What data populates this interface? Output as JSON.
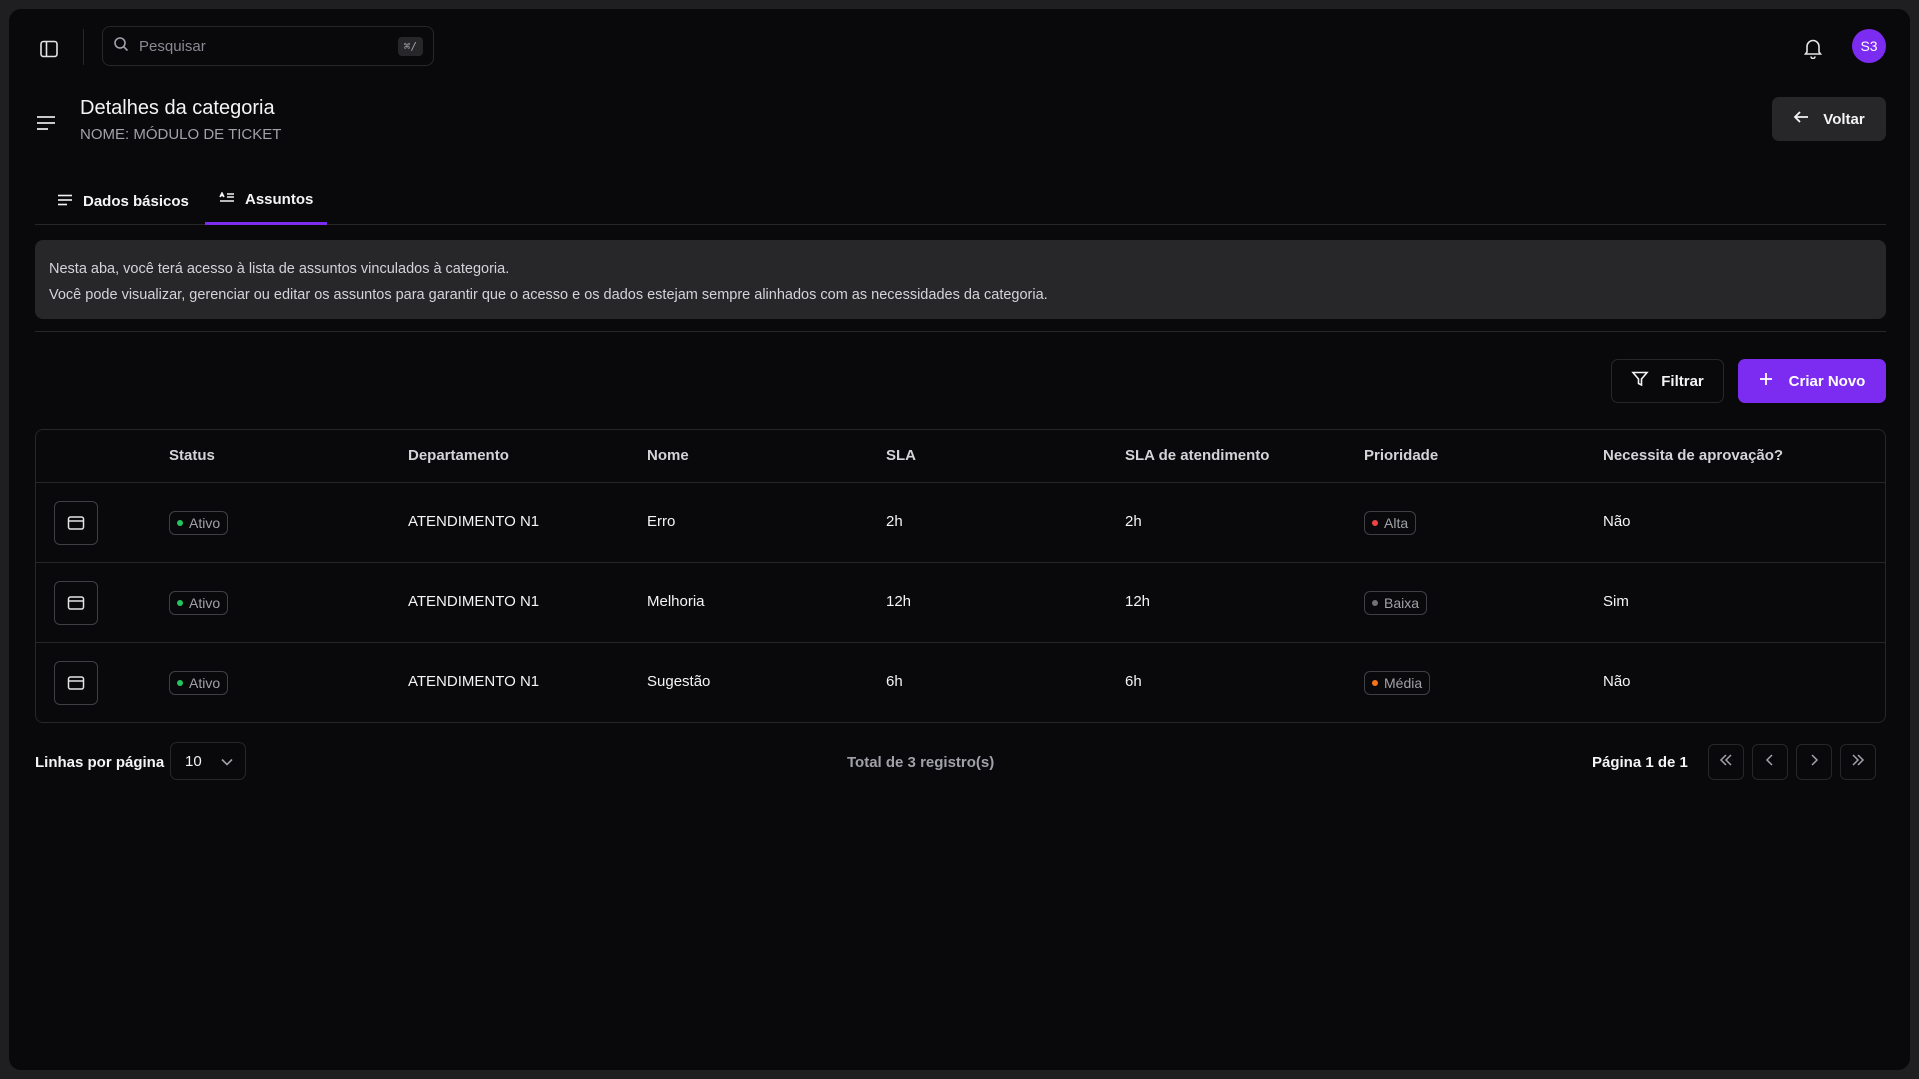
{
  "topbar": {
    "search_placeholder": "Pesquisar",
    "search_shortcut": "⌘/",
    "avatar_initials": "S3"
  },
  "header": {
    "title": "Detalhes da categoria",
    "subtitle": "NOME: MÓDULO DE TICKET",
    "back_label": "Voltar"
  },
  "tabs": [
    {
      "label": "Dados básicos",
      "icon": "lines-icon",
      "active": false
    },
    {
      "label": "Assuntos",
      "icon": "list-text-icon",
      "active": true
    }
  ],
  "info": {
    "line1": "Nesta aba, você terá acesso à lista de assuntos vinculados à categoria.",
    "line2": "Você pode visualizar, gerenciar ou editar os assuntos para garantir que o acesso e os dados estejam sempre alinhados com as necessidades da categoria."
  },
  "actions": {
    "filter_label": "Filtrar",
    "create_label": "Criar Novo"
  },
  "table": {
    "columns": [
      "Status",
      "Departamento",
      "Nome",
      "SLA",
      "SLA de atendimento",
      "Prioridade",
      "Necessita de aprovação?"
    ],
    "rows": [
      {
        "status": "Ativo",
        "departamento": "ATENDIMENTO N1",
        "nome": "Erro",
        "sla": "2h",
        "sla_atendimento": "2h",
        "prioridade": "Alta",
        "aprovacao": "Não"
      },
      {
        "status": "Ativo",
        "departamento": "ATENDIMENTO N1",
        "nome": "Melhoria",
        "sla": "12h",
        "sla_atendimento": "12h",
        "prioridade": "Baixa",
        "aprovacao": "Sim"
      },
      {
        "status": "Ativo",
        "departamento": "ATENDIMENTO N1",
        "nome": "Sugestão",
        "sla": "6h",
        "sla_atendimento": "6h",
        "prioridade": "Média",
        "aprovacao": "Não"
      }
    ]
  },
  "pagination": {
    "rows_per_page_label": "Linhas por página",
    "rows_per_page_value": "10",
    "total_label": "Total de 3 registro(s)",
    "page_label": "Página 1 de 1"
  },
  "colors": {
    "accent": "#7c2cf0",
    "status_active": "#22c55e",
    "priority_high": "#ef4444",
    "priority_low": "#71717a",
    "priority_medium": "#f97316"
  }
}
